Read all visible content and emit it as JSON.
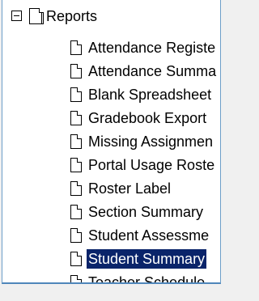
{
  "tree": {
    "root": {
      "label": "Reports",
      "expander": "collapse-minus",
      "icon": "document-stack-icon"
    },
    "items": [
      {
        "label": "Attendance Registe",
        "icon": "document-icon",
        "selected": false
      },
      {
        "label": "Attendance Summa",
        "icon": "document-icon",
        "selected": false
      },
      {
        "label": "Blank Spreadsheet",
        "icon": "document-icon",
        "selected": false
      },
      {
        "label": "Gradebook Export",
        "icon": "document-icon",
        "selected": false
      },
      {
        "label": "Missing Assignmen",
        "icon": "document-icon",
        "selected": false
      },
      {
        "label": "Portal Usage Roste",
        "icon": "document-icon",
        "selected": false
      },
      {
        "label": "Roster Label",
        "icon": "document-icon",
        "selected": false
      },
      {
        "label": "Section Summary",
        "icon": "document-icon",
        "selected": false
      },
      {
        "label": "Student Assessme",
        "icon": "document-icon",
        "selected": false
      },
      {
        "label": "Student Summary",
        "icon": "document-icon",
        "selected": true
      },
      {
        "label": "Teacher Schedule",
        "icon": "document-icon",
        "selected": false
      }
    ],
    "colors": {
      "selection_bg": "#0a246a",
      "selection_fg": "#ffffff",
      "border": "#4f86ba"
    }
  }
}
